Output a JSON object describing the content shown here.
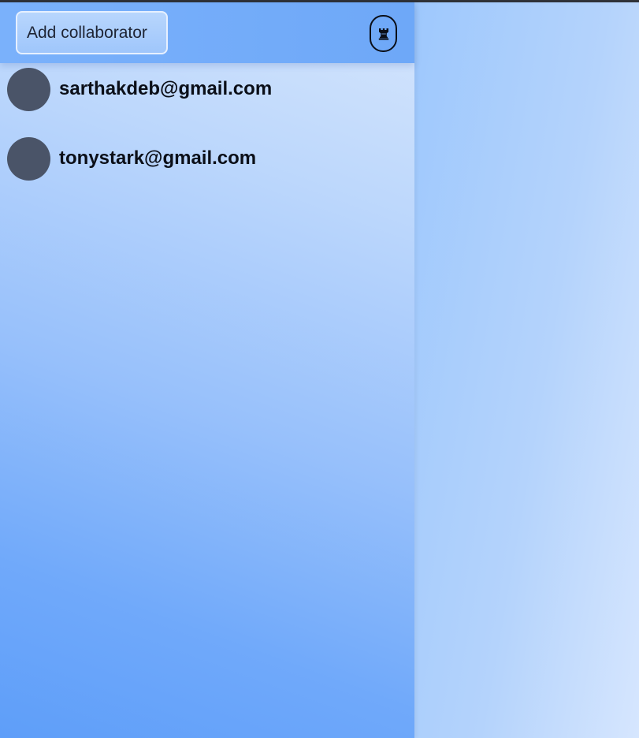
{
  "header": {
    "add_collaborator_label": "Add collaborator",
    "toggle_icon": "chess-rook-icon"
  },
  "collaborators": [
    {
      "email": "sarthakdeb@gmail.com",
      "avatar_color": "#4a5468"
    },
    {
      "email": "tonystark@gmail.com",
      "avatar_color": "#4a5468"
    }
  ],
  "colors": {
    "header_bg": "#72abf9",
    "sidebar_accent": "#5e9ef9",
    "text": "#0b0f18"
  }
}
